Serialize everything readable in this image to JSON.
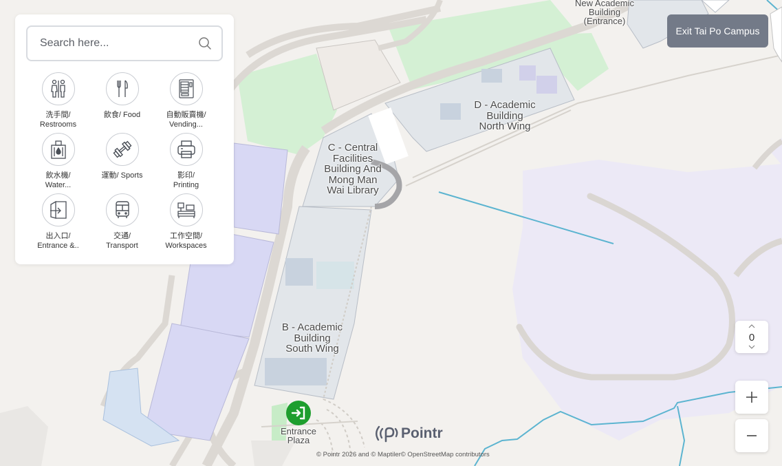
{
  "search": {
    "placeholder": "Search here..."
  },
  "categories": [
    {
      "label": "洗手間/\nRestrooms",
      "icon": "restroom-icon"
    },
    {
      "label": "飲食/ Food",
      "icon": "food-icon"
    },
    {
      "label": "自動販賣機/\nVending...",
      "icon": "vending-machine-icon"
    },
    {
      "label": "飲水機/\nWater...",
      "icon": "water-dispenser-icon"
    },
    {
      "label": "運動/ Sports",
      "icon": "dumbbell-icon"
    },
    {
      "label": "影印/\nPrinting",
      "icon": "printer-icon"
    },
    {
      "label": "出入口/\nEntrance &..",
      "icon": "entrance-exit-icon"
    },
    {
      "label": "交通/\nTransport",
      "icon": "bus-icon"
    },
    {
      "label": "工作空間/\nWorkspaces",
      "icon": "workspace-icon"
    }
  ],
  "exit_button": "Exit Tai Po Campus",
  "floor": {
    "value": "0"
  },
  "map_labels": {
    "new_academic": "New Academic\nBuilding\n(Entrance)",
    "d_building": "D - Academic\nBuilding\nNorth Wing",
    "c_building": "C - Central\nFacilities\nBuilding And\nMong Man\nWai Library",
    "b_building": "B - Academic\nBuilding\nSouth Wing",
    "entrance_plaza": "Entrance\nPlaza"
  },
  "logo": "Pointr",
  "attribution": "© Pointr 2026 and © Maptiler© OpenStreetMap contributors",
  "colors": {
    "background": "#f3f1ee",
    "green_area": "#d4f0d4",
    "purple_area": "#d8d8f4",
    "light_purple_area": "#ece9f6",
    "water_line": "#5bb4d0",
    "exit_button": "#737a88",
    "entrance_icon": "#1e9e2e"
  }
}
